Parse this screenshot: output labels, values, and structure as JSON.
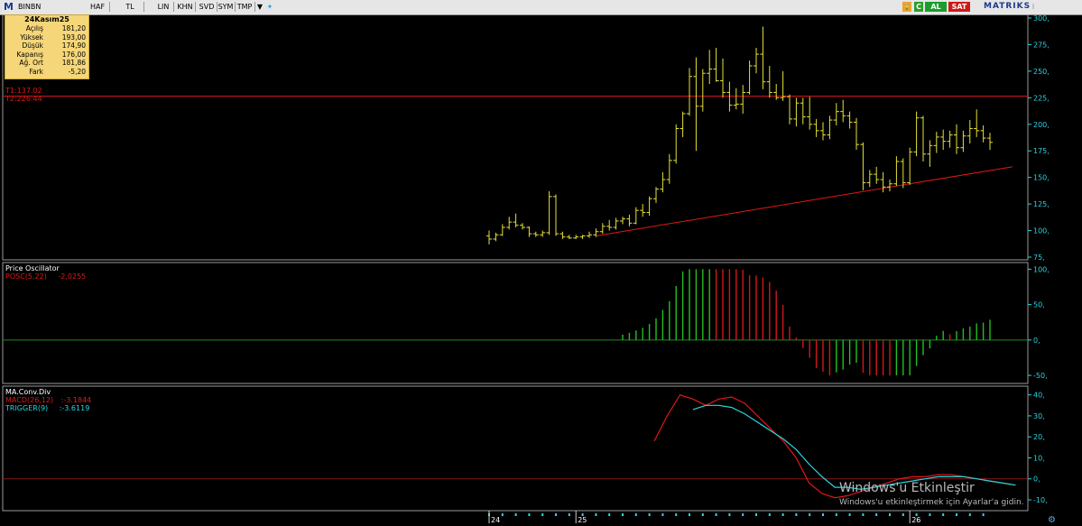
{
  "toolbar": {
    "symbol": "BINBN",
    "buttons": [
      "HAF",
      "TL",
      "LIN",
      "KHN",
      "SVD",
      "SYM",
      "TMP"
    ],
    "buy_label": "AL",
    "sell_label": "SAT",
    "brand": "MATRIKS"
  },
  "info_box": {
    "date": "24Kasım25",
    "rows": [
      {
        "label": "Açılış",
        "value": "181,20"
      },
      {
        "label": "Yüksek",
        "value": "193,00"
      },
      {
        "label": "Düşük",
        "value": "174,90"
      },
      {
        "label": "Kapanış",
        "value": "176,00"
      },
      {
        "label": "Ağ. Ort",
        "value": "181,86"
      },
      {
        "label": "Fark",
        "value": "-5,20"
      }
    ]
  },
  "overlays": {
    "t1": "T1:137.02",
    "t2": "T2:226.44",
    "osc_title": "Price Oscillator",
    "osc_label": "POSC(5,22)",
    "osc_value": "-2,0255",
    "macd_title": "MA.Conv.Div",
    "macd_label": "MACD(26,12)",
    "macd_value": ":-3.1844",
    "trig_label": "TRIGGER(9)",
    "trig_value": ":-3.6119"
  },
  "watermark": {
    "line1": "Windows'u Etkinleştir",
    "line2": "Windows'u etkinleştirmek için Ayarlar'a gidin."
  },
  "colors": {
    "price_bars": "#e6e03a",
    "trendline": "#e01818",
    "osc_up": "#21c021",
    "osc_down": "#d01818",
    "macd": "#e01818",
    "trigger": "#2ad4e0",
    "axis_text": "#2ad4e0"
  },
  "chart_data": [
    {
      "type": "ohlc",
      "ylim": [
        75,
        300
      ],
      "yticks": [
        75,
        100,
        125,
        150,
        175,
        200,
        225,
        250,
        275,
        300
      ],
      "x_labels": [
        "24",
        "25",
        "26"
      ],
      "horizontal_line": 226.44,
      "trendline": {
        "from": {
          "bar": 16,
          "y": 95
        },
        "to": {
          "bar": 77,
          "y": 160
        }
      },
      "bars": [
        {
          "o": 95,
          "h": 100,
          "l": 87,
          "c": 92
        },
        {
          "o": 92,
          "h": 98,
          "l": 90,
          "c": 96
        },
        {
          "o": 96,
          "h": 106,
          "l": 95,
          "c": 103
        },
        {
          "o": 103,
          "h": 113,
          "l": 101,
          "c": 108
        },
        {
          "o": 108,
          "h": 116,
          "l": 103,
          "c": 105
        },
        {
          "o": 105,
          "h": 107,
          "l": 101,
          "c": 103
        },
        {
          "o": 103,
          "h": 104,
          "l": 94,
          "c": 97
        },
        {
          "o": 97,
          "h": 99,
          "l": 94,
          "c": 96
        },
        {
          "o": 96,
          "h": 100,
          "l": 94,
          "c": 98
        },
        {
          "o": 98,
          "h": 137,
          "l": 96,
          "c": 132
        },
        {
          "o": 132,
          "h": 134,
          "l": 95,
          "c": 97
        },
        {
          "o": 97,
          "h": 99,
          "l": 92,
          "c": 94
        },
        {
          "o": 94,
          "h": 96,
          "l": 92,
          "c": 93
        },
        {
          "o": 93,
          "h": 96,
          "l": 92,
          "c": 94
        },
        {
          "o": 94,
          "h": 96,
          "l": 92,
          "c": 95
        },
        {
          "o": 95,
          "h": 99,
          "l": 93,
          "c": 96
        },
        {
          "o": 96,
          "h": 102,
          "l": 94,
          "c": 99
        },
        {
          "o": 99,
          "h": 107,
          "l": 97,
          "c": 104
        },
        {
          "o": 104,
          "h": 110,
          "l": 100,
          "c": 103
        },
        {
          "o": 103,
          "h": 112,
          "l": 101,
          "c": 109
        },
        {
          "o": 109,
          "h": 113,
          "l": 106,
          "c": 111
        },
        {
          "o": 111,
          "h": 115,
          "l": 104,
          "c": 107
        },
        {
          "o": 107,
          "h": 122,
          "l": 106,
          "c": 119
        },
        {
          "o": 119,
          "h": 125,
          "l": 113,
          "c": 117
        },
        {
          "o": 117,
          "h": 132,
          "l": 114,
          "c": 130
        },
        {
          "o": 130,
          "h": 141,
          "l": 126,
          "c": 139
        },
        {
          "o": 139,
          "h": 155,
          "l": 136,
          "c": 148
        },
        {
          "o": 148,
          "h": 172,
          "l": 144,
          "c": 166
        },
        {
          "o": 166,
          "h": 200,
          "l": 163,
          "c": 196
        },
        {
          "o": 196,
          "h": 212,
          "l": 188,
          "c": 210
        },
        {
          "o": 210,
          "h": 253,
          "l": 208,
          "c": 245
        },
        {
          "o": 245,
          "h": 263,
          "l": 175,
          "c": 217
        },
        {
          "o": 217,
          "h": 252,
          "l": 212,
          "c": 248
        },
        {
          "o": 248,
          "h": 270,
          "l": 238,
          "c": 252
        },
        {
          "o": 252,
          "h": 272,
          "l": 240,
          "c": 241
        },
        {
          "o": 241,
          "h": 262,
          "l": 225,
          "c": 230
        },
        {
          "o": 230,
          "h": 240,
          "l": 212,
          "c": 218
        },
        {
          "o": 218,
          "h": 234,
          "l": 214,
          "c": 219
        },
        {
          "o": 219,
          "h": 237,
          "l": 210,
          "c": 230
        },
        {
          "o": 230,
          "h": 260,
          "l": 228,
          "c": 255
        },
        {
          "o": 255,
          "h": 272,
          "l": 248,
          "c": 266
        },
        {
          "o": 266,
          "h": 292,
          "l": 233,
          "c": 240
        },
        {
          "o": 240,
          "h": 255,
          "l": 225,
          "c": 230
        },
        {
          "o": 230,
          "h": 238,
          "l": 223,
          "c": 225
        },
        {
          "o": 225,
          "h": 250,
          "l": 222,
          "c": 226
        },
        {
          "o": 226,
          "h": 228,
          "l": 200,
          "c": 205
        },
        {
          "o": 205,
          "h": 225,
          "l": 198,
          "c": 220
        },
        {
          "o": 220,
          "h": 225,
          "l": 200,
          "c": 207
        },
        {
          "o": 207,
          "h": 226,
          "l": 195,
          "c": 200
        },
        {
          "o": 200,
          "h": 205,
          "l": 188,
          "c": 194
        },
        {
          "o": 194,
          "h": 202,
          "l": 185,
          "c": 190
        },
        {
          "o": 190,
          "h": 208,
          "l": 186,
          "c": 204
        },
        {
          "o": 204,
          "h": 220,
          "l": 199,
          "c": 212
        },
        {
          "o": 212,
          "h": 223,
          "l": 202,
          "c": 208
        },
        {
          "o": 208,
          "h": 212,
          "l": 196,
          "c": 202
        },
        {
          "o": 202,
          "h": 206,
          "l": 176,
          "c": 181
        },
        {
          "o": 181,
          "h": 183,
          "l": 138,
          "c": 145
        },
        {
          "o": 145,
          "h": 157,
          "l": 141,
          "c": 153
        },
        {
          "o": 153,
          "h": 160,
          "l": 144,
          "c": 148
        },
        {
          "o": 148,
          "h": 155,
          "l": 136,
          "c": 141
        },
        {
          "o": 141,
          "h": 148,
          "l": 137,
          "c": 144
        },
        {
          "o": 144,
          "h": 170,
          "l": 142,
          "c": 165
        },
        {
          "o": 165,
          "h": 168,
          "l": 140,
          "c": 145
        },
        {
          "o": 145,
          "h": 178,
          "l": 143,
          "c": 174
        },
        {
          "o": 174,
          "h": 212,
          "l": 170,
          "c": 206
        },
        {
          "o": 206,
          "h": 208,
          "l": 165,
          "c": 172
        },
        {
          "o": 172,
          "h": 185,
          "l": 160,
          "c": 180
        },
        {
          "o": 180,
          "h": 193,
          "l": 173,
          "c": 188
        },
        {
          "o": 188,
          "h": 195,
          "l": 176,
          "c": 184
        },
        {
          "o": 184,
          "h": 194,
          "l": 178,
          "c": 190
        },
        {
          "o": 190,
          "h": 200,
          "l": 172,
          "c": 178
        },
        {
          "o": 178,
          "h": 194,
          "l": 174,
          "c": 189
        },
        {
          "o": 189,
          "h": 204,
          "l": 182,
          "c": 196
        },
        {
          "o": 196,
          "h": 214,
          "l": 188,
          "c": 194
        },
        {
          "o": 194,
          "h": 199,
          "l": 183,
          "c": 187
        },
        {
          "o": 187,
          "h": 192,
          "l": 176,
          "c": 183
        }
      ]
    },
    {
      "type": "bar",
      "name": "POSC(5,22)",
      "ylim": [
        -55,
        103
      ],
      "yticks": [
        -50,
        0,
        50,
        100
      ]
    },
    {
      "type": "line",
      "ylim": [
        -13,
        42
      ],
      "yticks": [
        -10,
        0,
        10,
        20,
        30,
        40
      ],
      "series": [
        {
          "name": "MACD(26,12)",
          "values": [
            18,
            30,
            40,
            38,
            35,
            38,
            39,
            36,
            30,
            24,
            18,
            10,
            -2,
            -7,
            -9,
            -8,
            -6,
            -4,
            -2,
            0,
            1,
            1,
            2,
            2,
            1,
            0,
            -1,
            -2,
            -3
          ]
        },
        {
          "name": "TRIGGER(9)",
          "values": [
            null,
            null,
            null,
            33,
            35,
            35,
            34,
            31,
            27,
            23,
            19,
            14,
            7,
            1,
            -4,
            -4,
            -5,
            -4,
            -3,
            -2,
            -1,
            0,
            1,
            1,
            1,
            0,
            -1,
            -2,
            -3
          ]
        }
      ]
    }
  ]
}
